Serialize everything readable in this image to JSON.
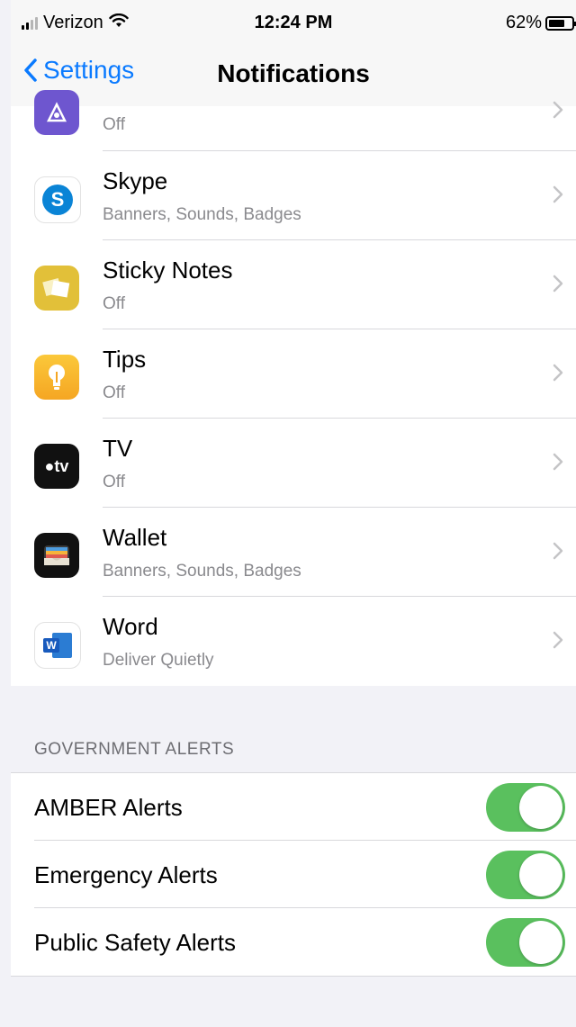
{
  "status_bar": {
    "carrier": "Verizon",
    "time": "12:24 PM",
    "battery": "62%",
    "signal_icon": "signal-bars-icon",
    "wifi_icon": "wifi-icon",
    "battery_icon": "battery-icon"
  },
  "nav": {
    "back_label": "Settings",
    "title": "Notifications"
  },
  "apps": [
    {
      "name": "",
      "status": "Off",
      "icon": "testflight-icon"
    },
    {
      "name": "Skype",
      "status": "Banners, Sounds, Badges",
      "icon": "skype-icon"
    },
    {
      "name": "Sticky Notes",
      "status": "Off",
      "icon": "sticky-notes-icon"
    },
    {
      "name": "Tips",
      "status": "Off",
      "icon": "tips-lightbulb-icon"
    },
    {
      "name": "TV",
      "status": "Off",
      "icon": "apple-tv-icon"
    },
    {
      "name": "Wallet",
      "status": "Banners, Sounds, Badges",
      "icon": "wallet-icon"
    },
    {
      "name": "Word",
      "status": "Deliver Quietly",
      "icon": "word-icon"
    }
  ],
  "tv_icon_text": "tv",
  "word_icon_text": "W",
  "skype_icon_text": "S",
  "government_alerts": {
    "header": "GOVERNMENT ALERTS",
    "items": [
      {
        "label": "AMBER Alerts",
        "enabled": true
      },
      {
        "label": "Emergency Alerts",
        "enabled": true
      },
      {
        "label": "Public Safety Alerts",
        "enabled": true
      }
    ]
  },
  "colors": {
    "accent": "#0a7aff",
    "toggle_on": "#5ac05e"
  }
}
